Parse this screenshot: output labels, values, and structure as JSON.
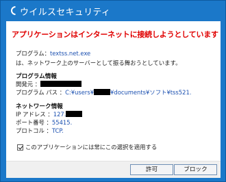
{
  "window": {
    "title": "ウイルスセキュリティ"
  },
  "alert": {
    "heading": "アプリケーションはインターネットに接続しようとしています"
  },
  "program": {
    "label": "プログラム：",
    "name": "textss.net.exe",
    "description": "は、ネットワーク上のサーバーとして振る舞おうとしています。"
  },
  "program_info": {
    "header": "プログラム情報",
    "developer_label": "開発元 ：",
    "path_label": "プログラム パス ：",
    "path_prefix": "C:¥users¥",
    "path_suffix": "¥documents¥ソフト¥tss521."
  },
  "network_info": {
    "header": "ネットワーク情報",
    "ip_label": "IP アドレス ：",
    "ip_value": "127.",
    "port_label": "ポート番号 ：",
    "port_value": "55415.",
    "protocol_label": "プロトコル ：",
    "protocol_value": "TCP."
  },
  "options": {
    "always_apply": "このアプリケーションには常にこの選択を適用する",
    "always_apply_checked": true
  },
  "buttons": {
    "allow": "許可",
    "block": "ブロック"
  },
  "colors": {
    "frame": "#1b78c9",
    "alert": "#e00000",
    "value": "#1a4fb0"
  }
}
